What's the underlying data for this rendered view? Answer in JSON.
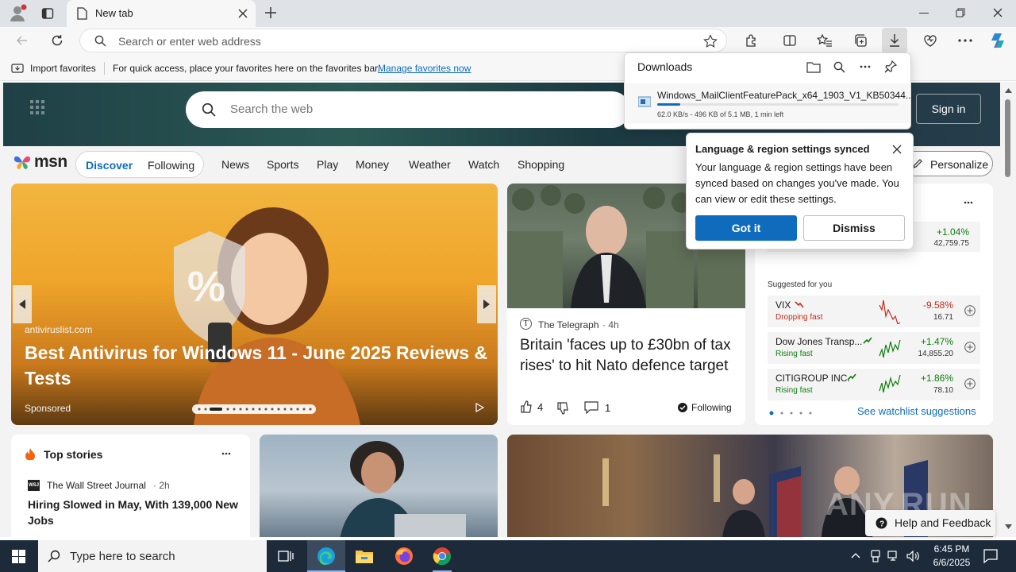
{
  "browser": {
    "tab_title": "New tab",
    "address_placeholder": "Search or enter web address",
    "favorites_bar": {
      "import_label": "Import favorites",
      "hint": "For quick access, place your favorites here on the favorites bar.",
      "manage_link": "Manage favorites now"
    }
  },
  "downloads": {
    "title": "Downloads",
    "file_name": "Windows_MailClientFeaturePack_x64_1903_V1_KB50344...",
    "status": "62.0 KB/s - 496 KB of 5.1 MB, 1 min left",
    "progress": 0.095
  },
  "msn": {
    "logo": "msn",
    "search_placeholder": "Search the web",
    "sign_in": "Sign in",
    "feed_tabs": [
      "Discover",
      "Following"
    ],
    "nav": [
      "News",
      "Sports",
      "Play",
      "Money",
      "Weather",
      "Watch",
      "Shopping"
    ],
    "personalize": "Personalize"
  },
  "sync_popup": {
    "title": "Language & region settings synced",
    "body": "Your language & region settings have been synced based on changes you've made. You can view or edit these settings.",
    "primary": "Got it",
    "secondary": "Dismiss"
  },
  "hero_card": {
    "source": "antiviruslist.com",
    "title": "Best Antivirus for Windows 11 - June 2025 Reviews & Tests",
    "sponsored": "Sponsored"
  },
  "telegraph_card": {
    "source": "The Telegraph",
    "age": "· 4h",
    "title": "Britain 'faces up to £30bn of tax rises' to hit Nato defence target",
    "likes": "4",
    "comments": "1",
    "following": "Following"
  },
  "watchlist": {
    "top_change": "+1.04%",
    "top_value": "42,759.75",
    "suggested_label": "Suggested for you",
    "stocks": [
      {
        "name": "VIX",
        "sub": "Dropping fast",
        "change": "-9.58%",
        "value": "16.71",
        "down": true
      },
      {
        "name": "Dow Jones Transp...",
        "sub": "Rising fast",
        "change": "+1.47%",
        "value": "14,855.20",
        "down": false
      },
      {
        "name": "CITIGROUP INC.",
        "sub": "Rising fast",
        "change": "+1.86%",
        "value": "78.10",
        "down": false
      }
    ],
    "see_link": "See watchlist suggestions"
  },
  "top_stories": {
    "header": "Top stories",
    "source": "The Wall Street Journal",
    "source_abbr": "WSJ",
    "age": "· 2h",
    "headline": "Hiring Slowed in May, With 139,000 New Jobs"
  },
  "help": "Help and Feedback",
  "watermark": "ANY.RUN",
  "taskbar": {
    "search_placeholder": "Type here to search",
    "time": "6:45 PM",
    "date": "6/6/2025"
  },
  "colors": {
    "accent": "#0f6cbd",
    "positive": "#107c10",
    "negative": "#c42b1c"
  }
}
